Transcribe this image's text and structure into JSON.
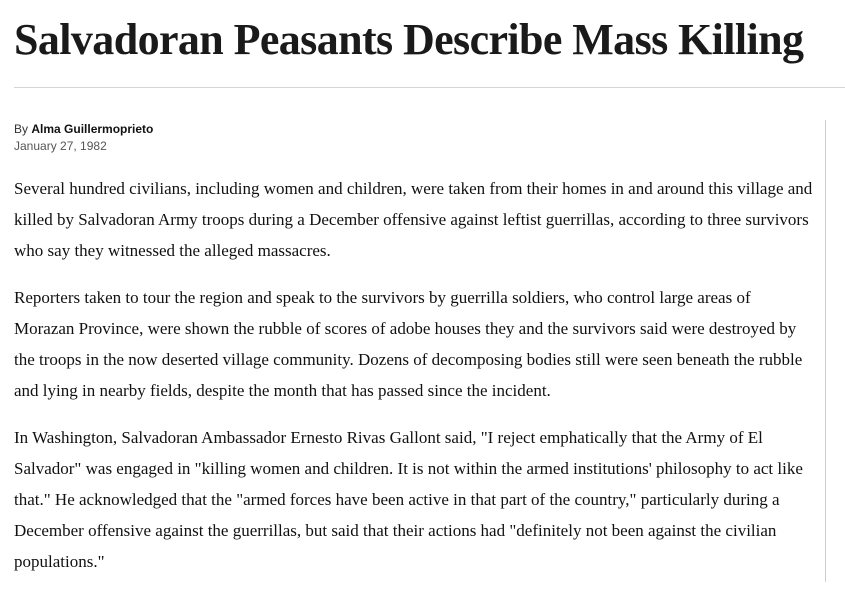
{
  "article": {
    "headline": "Salvadoran Peasants Describe Mass Killing",
    "byline_prefix": "By",
    "author": "Alma Guillermoprieto",
    "date": "January 27, 1982",
    "paragraphs": [
      "Several hundred civilians, including women and children, were taken from their homes in and around this village and killed by Salvadoran Army troops during a December offensive against leftist guerrillas, according to three survivors who say they witnessed the alleged massacres.",
      "Reporters taken to tour the region and speak to the survivors by guerrilla soldiers, who control large areas of Morazan Province, were shown the rubble of scores of adobe houses they and the survivors said were destroyed by the troops in the now deserted village community. Dozens of decomposing bodies still were seen beneath the rubble and lying in nearby fields, despite the month that has passed since the incident.",
      "In Washington, Salvadoran Ambassador Ernesto Rivas Gallont said, \"I reject emphatically that the Army of El Salvador\" was engaged in \"killing women and children. It is not within the armed institutions' philosophy to act like that.\" He acknowledged that the \"armed forces have been active in that part of the country,\" particularly during a December offensive against the guerrillas, but said that their actions had \"definitely not been against the civilian populations.\""
    ]
  }
}
